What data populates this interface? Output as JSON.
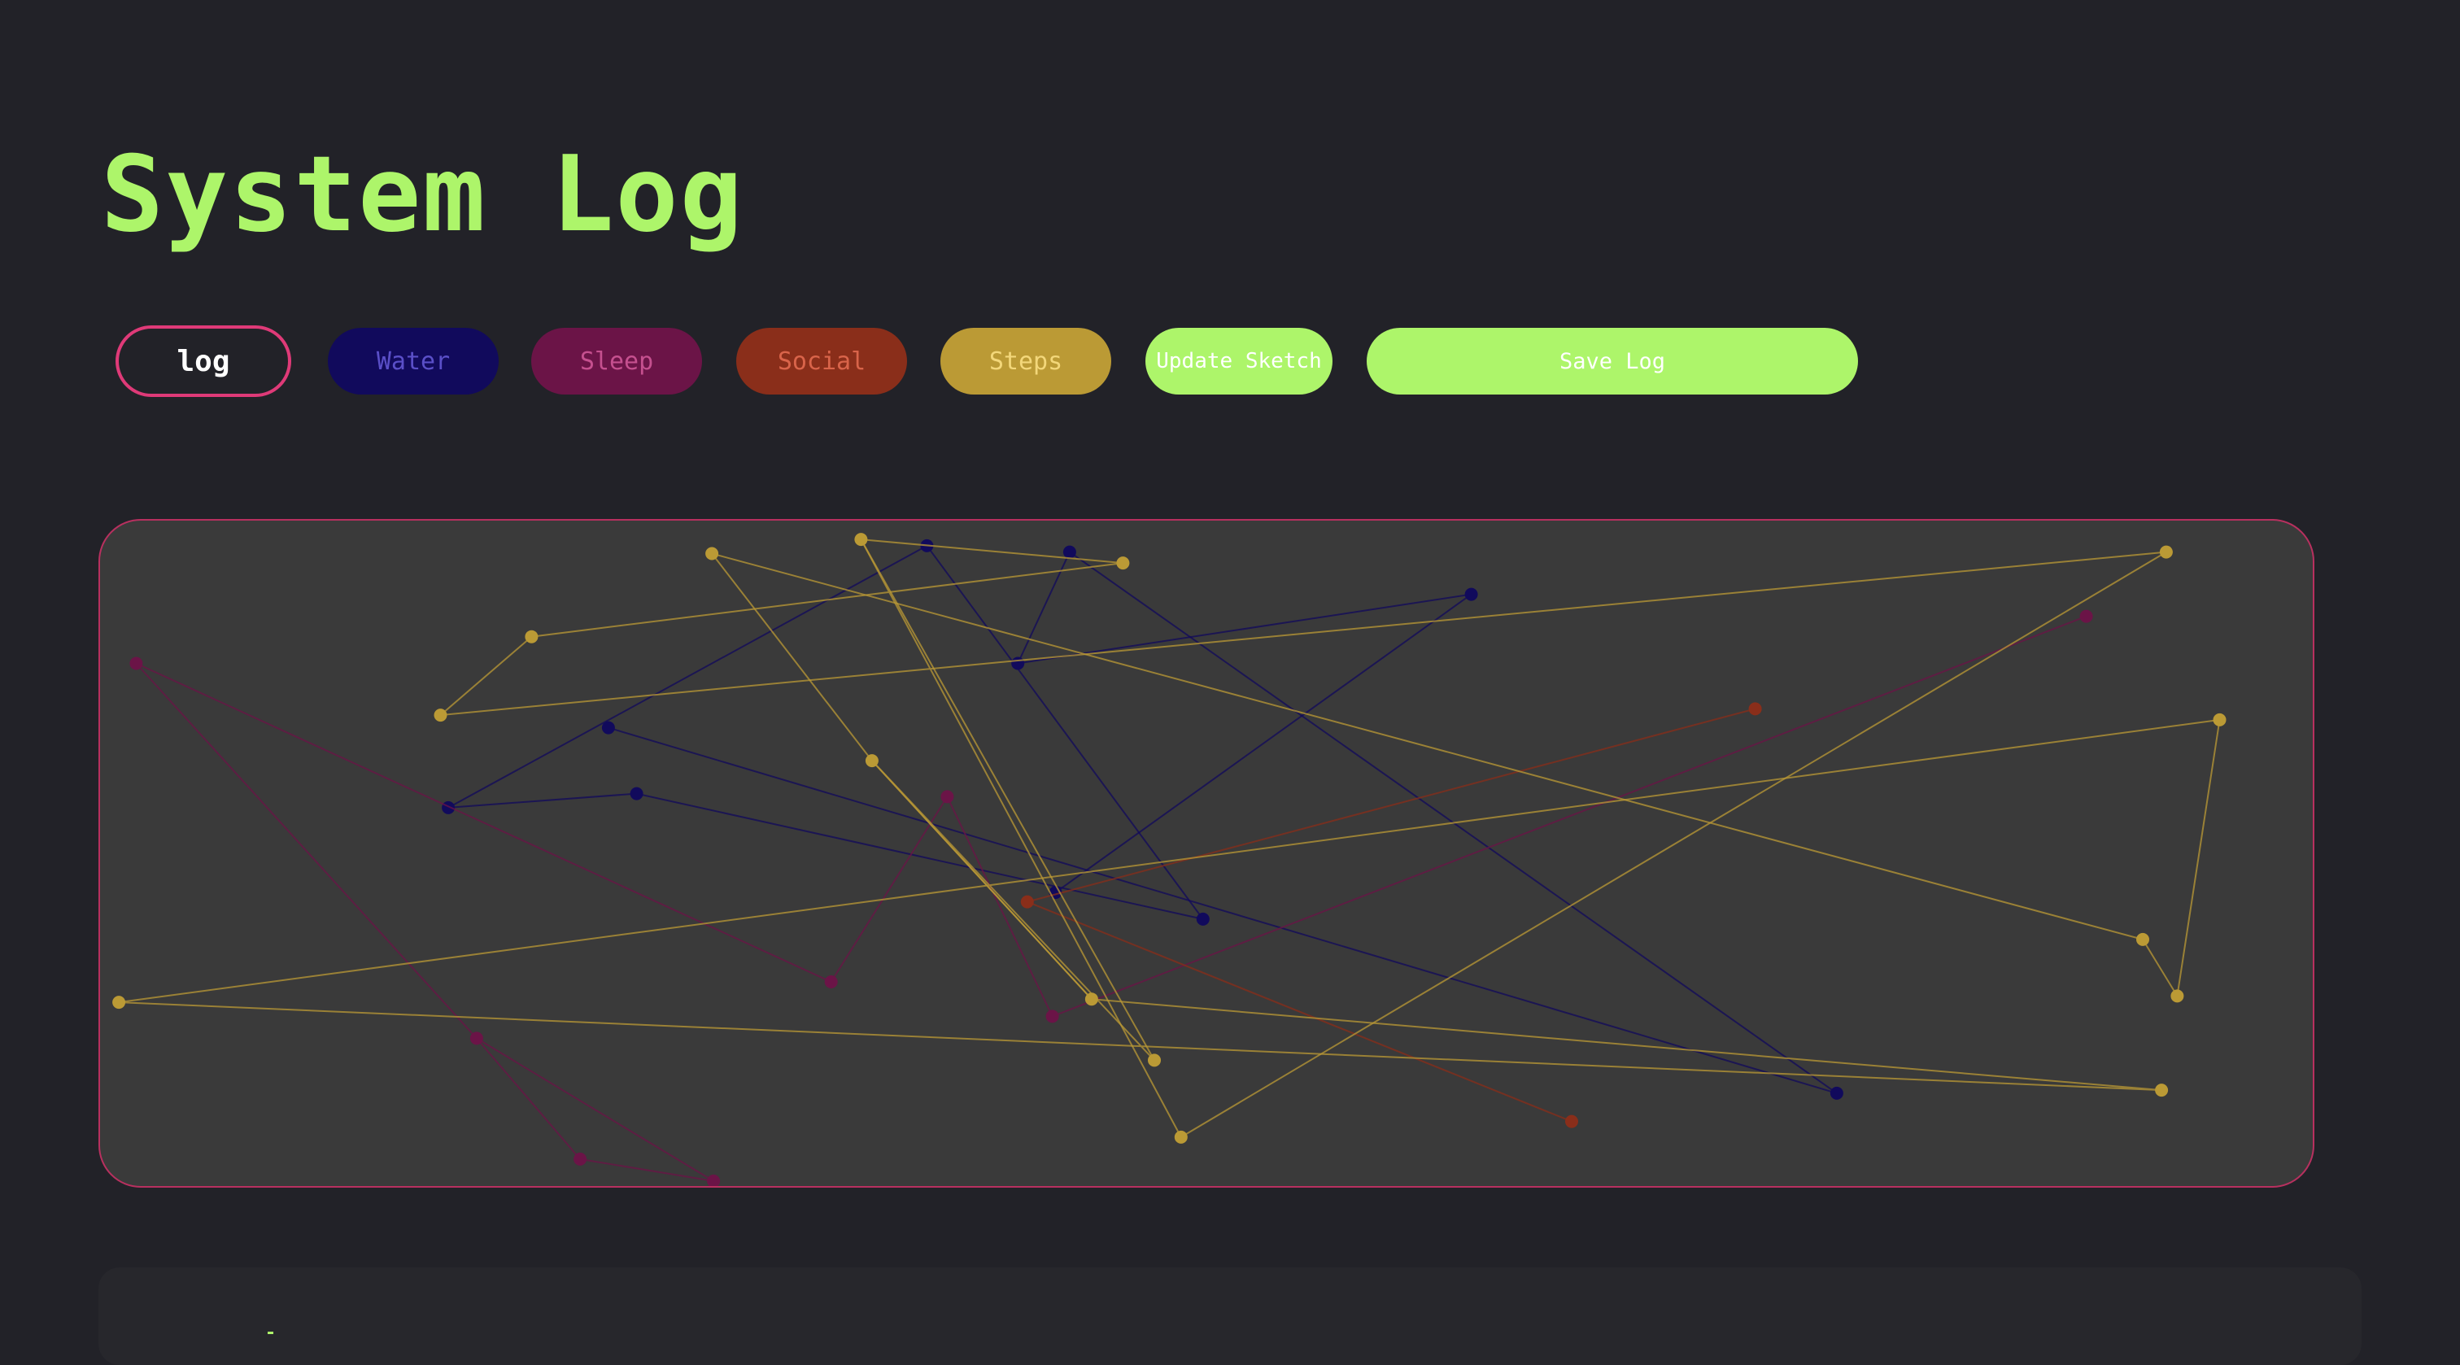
{
  "header": {
    "title": "System Log"
  },
  "toolbar": {
    "buttons": [
      {
        "label": "log",
        "active": true
      },
      {
        "label": "Water"
      },
      {
        "label": "Sleep"
      },
      {
        "label": "Social"
      },
      {
        "label": "Steps"
      },
      {
        "label": "Update Sketch"
      },
      {
        "label": "Save Log"
      }
    ]
  },
  "colors": {
    "background": "#222228",
    "accent": "#adf56a",
    "active_border": "#df3a78",
    "water": "#110a5c",
    "sleep": "#6b1447",
    "social": "#8a2e1a",
    "steps": "#bb9a35",
    "canvas": "#3a3a3a"
  }
}
